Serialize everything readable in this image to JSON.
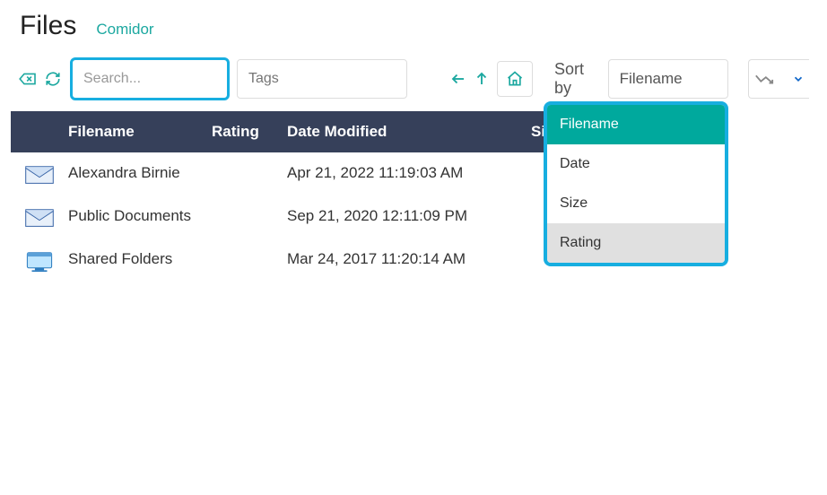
{
  "header": {
    "title": "Files",
    "brand": "Comidor"
  },
  "toolbar": {
    "search_placeholder": "Search...",
    "tags_placeholder": "Tags",
    "sort_label": "Sort by",
    "sort_value": "Filename"
  },
  "columns": {
    "name": "Filename",
    "rating": "Rating",
    "date": "Date Modified",
    "size": "Size"
  },
  "rows": [
    {
      "name": "Alexandra Birnie",
      "date": "Apr 21, 2022 11:19:03 AM"
    },
    {
      "name": "Public Documents",
      "date": "Sep 21, 2020 12:11:09 PM"
    },
    {
      "name": "Shared Folders",
      "date": "Mar 24, 2017 11:20:14 AM"
    }
  ],
  "dropdown": {
    "options": [
      "Filename",
      "Date",
      "Size",
      "Rating"
    ],
    "selected": "Filename",
    "hovered": "Rating"
  }
}
